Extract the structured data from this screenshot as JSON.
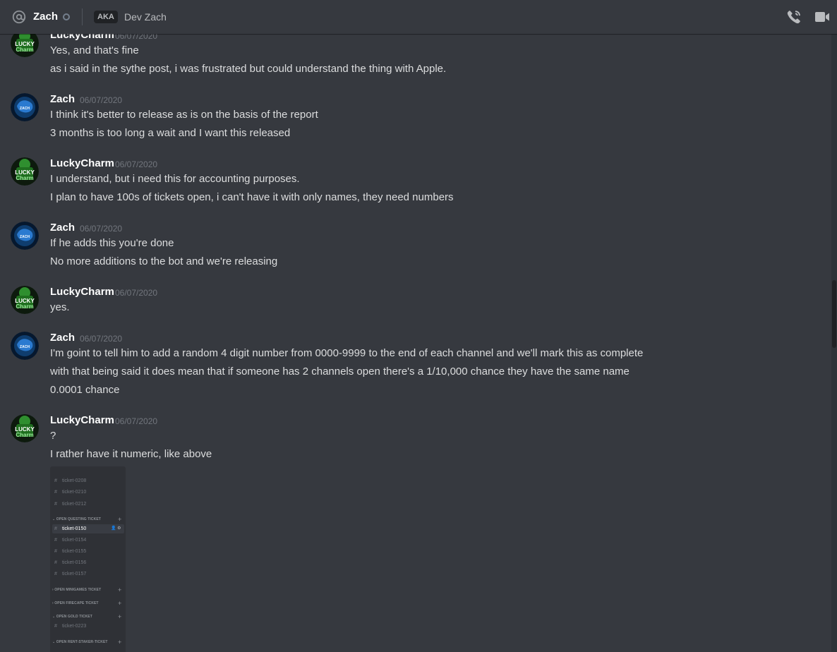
{
  "header": {
    "name": "Zach",
    "aka_label": "AKA",
    "aka_name": "Dev Zach"
  },
  "messages": [
    {
      "author": "LuckyCharm",
      "timestamp": "06/07/2020",
      "avatar": "luckycharm-avatar",
      "lines": [
        "Yes, and that's fine",
        "as i said in the sythe post, i was frustrated but could understand the thing with Apple."
      ]
    },
    {
      "author": "Zach",
      "timestamp": "06/07/2020",
      "avatar": "zach-avatar",
      "lines": [
        "I think it's better to release as is on the basis of the report",
        "3 months is too long a wait and I want this released"
      ]
    },
    {
      "author": "LuckyCharm",
      "timestamp": "06/07/2020",
      "avatar": "luckycharm-avatar",
      "lines": [
        "I understand, but i need this for accounting purposes.",
        "I plan to have 100s of tickets open, i can't have it with only names, they need numbers"
      ]
    },
    {
      "author": "Zach",
      "timestamp": "06/07/2020",
      "avatar": "zach-avatar",
      "lines": [
        "If he adds this you're done",
        "No more additions to the bot and we're releasing"
      ]
    },
    {
      "author": "LuckyCharm",
      "timestamp": "06/07/2020",
      "avatar": "luckycharm-avatar",
      "lines": [
        "yes."
      ]
    },
    {
      "author": "Zach",
      "timestamp": "06/07/2020",
      "avatar": "zach-avatar",
      "lines": [
        "I'm goint to tell him to add a random 4 digit number from 0000-9999 to the end of each channel and we'll mark this as complete",
        "with that being said it does mean that if someone has 2 channels open there's a 1/10,000 chance they have the same name",
        "0.0001 chance"
      ]
    },
    {
      "author": "LuckyCharm",
      "timestamp": "06/07/2020",
      "avatar": "luckycharm-avatar",
      "lines": [
        "?",
        "I rather have it numeric, like above"
      ]
    }
  ],
  "avatar_text": {
    "luckycharm": [
      "LUCKY",
      "Charm"
    ],
    "zach": "ZACH"
  },
  "attachment": {
    "items": [
      {
        "hash": "#",
        "label": "ticket-0208"
      },
      {
        "hash": "#",
        "label": "ticket-0210"
      },
      {
        "hash": "#",
        "label": "ticket-0212"
      },
      {
        "hash": "#",
        "label": "ticket-0150"
      },
      {
        "hash": "#",
        "label": "ticket-0154"
      },
      {
        "hash": "#",
        "label": "ticket-0155"
      },
      {
        "hash": "#",
        "label": "ticket-0156"
      },
      {
        "hash": "#",
        "label": "ticket-0157"
      },
      {
        "hash": "#",
        "label": "ticket-0223"
      }
    ],
    "categories": [
      {
        "arrow": "⌄",
        "label": "OPEN QUESTING TICKET",
        "plus": "+"
      },
      {
        "arrow": "›",
        "label": "OPEN MINIGAMES TICKET",
        "plus": "+"
      },
      {
        "arrow": "›",
        "label": "OPEN FIRECAPE TICKET",
        "plus": "+"
      },
      {
        "arrow": "⌄",
        "label": "OPEN GOLD TICKET",
        "plus": "+"
      },
      {
        "arrow": "⌄",
        "label": "OPEN RENT-STAKER-TICKET",
        "plus": "+"
      }
    ],
    "selected_icons": "👤 ⚙"
  },
  "colors": {
    "background": "#36393f",
    "author": "#ffffff",
    "text": "#dcddde",
    "timestamp": "#72767d",
    "attachment_bg": "#2f3136"
  }
}
